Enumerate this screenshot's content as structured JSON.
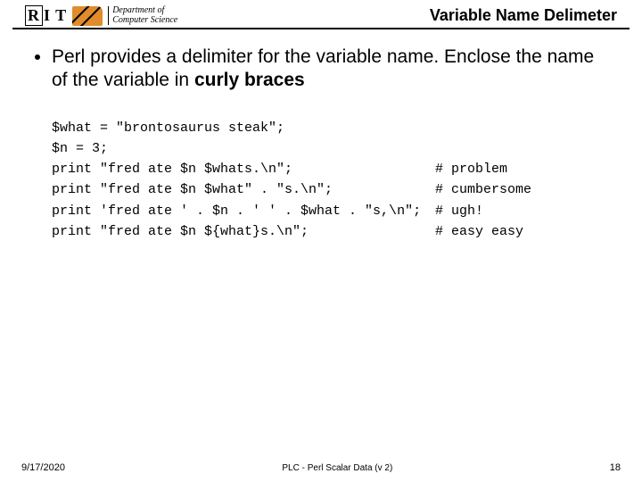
{
  "header": {
    "logo_r": "R",
    "logo_it": "I T",
    "dept_line1": "Department of",
    "dept_line2": "Computer Science",
    "title": "Variable Name Delimeter"
  },
  "bullet": {
    "text_before": "Perl provides a delimiter for the variable name.  Enclose the name of the variable in ",
    "bold": "curly braces"
  },
  "code": [
    {
      "left": "$what = \"brontosaurus steak\";",
      "right": ""
    },
    {
      "left": "$n = 3;",
      "right": ""
    },
    {
      "left": "print \"fred ate $n $whats.\\n\";",
      "right": "# problem"
    },
    {
      "left": "print \"fred ate $n $what\" . \"s.\\n\";",
      "right": "# cumbersome"
    },
    {
      "left": "print 'fred ate ' . $n . ' ' . $what . \"s,\\n\";",
      "right": "# ugh!"
    },
    {
      "left": "print \"fred ate $n ${what}s.\\n\";",
      "right": "# easy easy"
    }
  ],
  "footer": {
    "date": "9/17/2020",
    "center": "PLC - Perl Scalar Data (v 2)",
    "page": "18"
  }
}
